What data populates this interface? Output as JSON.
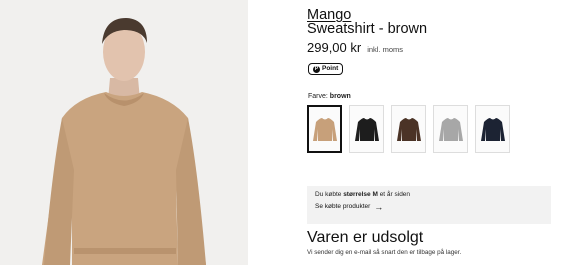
{
  "product": {
    "brand": "Mango",
    "title": "Sweatshirt - brown",
    "price": "299,00 kr",
    "vat_note": "inkl. moms",
    "badge": "Point",
    "badge_icon": "point-icon"
  },
  "color": {
    "label_prefix": "Farve:",
    "selected": "brown",
    "swatches": [
      {
        "name": "brown",
        "hex": "#c7a07a"
      },
      {
        "name": "black",
        "hex": "#1d1d1d"
      },
      {
        "name": "dark-brown",
        "hex": "#4b3326"
      },
      {
        "name": "grey",
        "hex": "#a7a7a7"
      },
      {
        "name": "navy",
        "hex": "#1c2333"
      }
    ]
  },
  "purchase_note": {
    "prefix": "Du købte",
    "size": "størrelse M",
    "suffix": "et år siden",
    "link": "Se købte produkter",
    "link_icon": "arrow-right-icon"
  },
  "availability": {
    "status": "Varen er udsolgt",
    "message": "Vi sender dig en e-mail så snart den er tilbage på lager."
  },
  "colors": {
    "background": "#ffffff",
    "panel": "#f2f2f2",
    "text": "#111111"
  }
}
